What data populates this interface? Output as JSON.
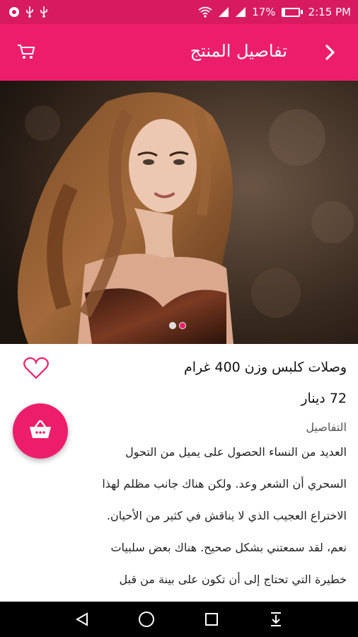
{
  "status_bar": {
    "battery_percent": "17%",
    "battery_level": 0.17,
    "time": "2:15 PM",
    "icons": [
      "notification-icon",
      "usb-icon",
      "usb-icon",
      "wifi-icon",
      "signal-icon",
      "signal-icon"
    ]
  },
  "app_bar": {
    "title": "تفاصيل المنتج",
    "left_icon": "cart-icon",
    "right_icon": "back-chevron-icon"
  },
  "carousel": {
    "slide_count": 2,
    "active_index": 1
  },
  "product": {
    "name": "وصلات كلبس وزن 400 غرام",
    "price": "72 دينار",
    "details_label": "التفاصيل",
    "description_lines": [
      "العديد من النساء الحصول على يميل من التحول",
      "السحري أن الشعر وعد. ولكن هناك جانب مظلم لهذا",
      "الاختراع العجيب الذي لا يناقش في كثير من الأحيان.",
      "نعم، لقد سمعتني بشكل صحيح. هناك بعض سلبيات",
      "خطيرة التي تحتاج إلى أن تكون على بينة من قبل"
    ]
  },
  "colors": {
    "status_bar": "#d81b60",
    "primary": "#ec1e6b",
    "nav_bar": "#000000"
  },
  "nav": [
    "back-triangle-icon",
    "home-circle-icon",
    "recents-square-icon",
    "notification-pull-icon"
  ]
}
